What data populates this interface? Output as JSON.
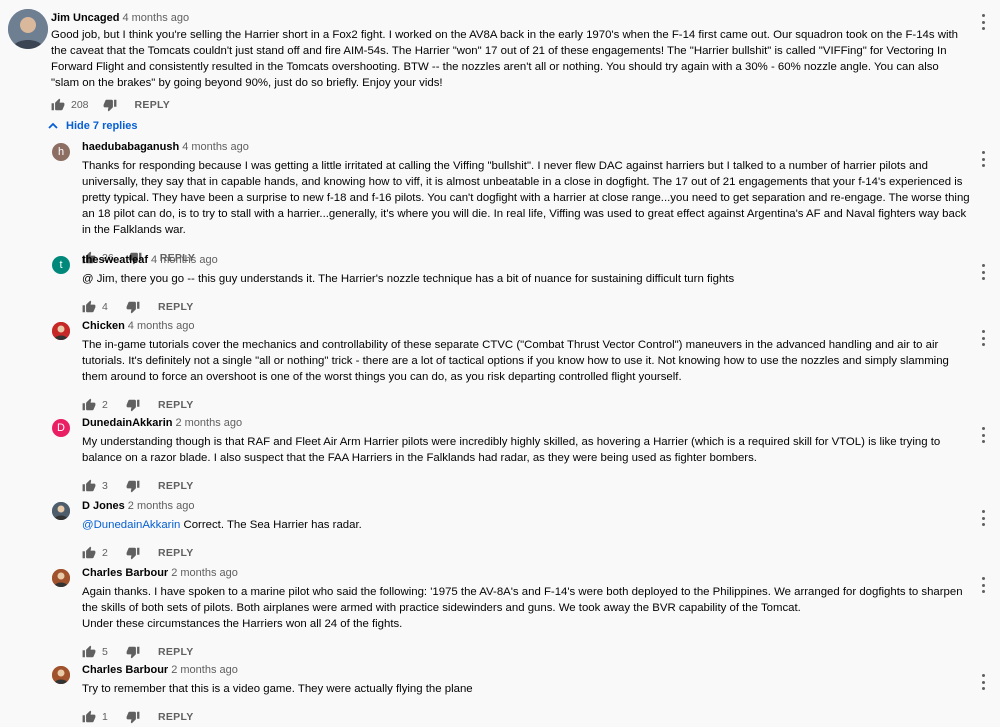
{
  "top_comment": {
    "author": "Jim Uncaged",
    "time": "4 months ago",
    "text": "Good job, but I think you're selling the Harrier short in a Fox2 fight.  I worked on the AV8A back in the early 1970's when the F-14 first came out.  Our squadron took on the F-14s with the caveat that the Tomcats couldn't just stand off and fire AIM-54s.  The Harrier \"won\" 17 out of 21 of these engagements!  The \"Harrier bullshit\" is called \"VIFFing\" for Vectoring In Forward Flight and consistently resulted in the Tomcats overshooting.  BTW -- the nozzles aren't all or nothing.  You should try again with a 30% - 60% nozzle angle.  You can also \"slam on the brakes\" by going beyond 90%, just do so briefly.  Enjoy your vids!",
    "likes": "208",
    "reply_label": "REPLY"
  },
  "hide_replies_label": "Hide 7 replies",
  "replies": [
    {
      "author": "haedubabaganush",
      "time": "4 months ago",
      "avatar_letter": "h",
      "avatar_color": "#8d6e63",
      "text": "Thanks for responding because I was getting a little irritated at calling the Viffing \"bullshit\". I never flew DAC against harriers but I talked to a number of harrier pilots and universally, they say that in capable hands,  and knowing how to viff, it is almost unbeatable in a close in dogfight. The 17 out of 21 engagements that your f-14's experienced is pretty typical. They have been a surprise to new f-18  and f-16 pilots. You can't dogfight with a harrier at close range...you need to get separation and re-engage. The worse thing an 18 pilot can do, is to try to stall with a harrier...generally, it's where you will die. In real life, Viffing was used to great effect against Argentina's AF and Naval fighters way back in the Falklands war.",
      "likes": "26",
      "reply_label": "REPLY"
    },
    {
      "author": "thesweatleaf",
      "time": "4 months ago",
      "avatar_letter": "t",
      "avatar_color": "#00897b",
      "text": "@ Jim, there you go -- this guy understands it. The Harrier's nozzle technique has a bit of nuance for sustaining difficult turn fights",
      "likes": "4",
      "reply_label": "REPLY"
    },
    {
      "author": "Chicken",
      "time": "4 months ago",
      "avatar_letter": "",
      "avatar_color": "#c62828",
      "text": "The in-game tutorials cover the mechanics and controllability of these separate CTVC (\"Combat Thrust Vector Control\") maneuvers in the advanced handling and air to air tutorials. It's definitely not a single \"all or nothing\" trick - there are a lot of tactical options if you know how to use it. Not knowing how to use the nozzles and simply slamming them around to force an overshoot is one of the worst things you can do, as you risk departing controlled flight yourself.",
      "likes": "2",
      "reply_label": "REPLY"
    },
    {
      "author": "DunedainAkkarin",
      "time": "2 months ago",
      "avatar_letter": "D",
      "avatar_color": "#e91e63",
      "text": "My understanding though is that RAF and Fleet Air Arm Harrier pilots were incredibly highly skilled, as hovering a Harrier (which is a required skill for VTOL) is like trying to balance on a razor blade. I also suspect that the FAA Harriers in the Falklands had radar, as they were being used as fighter bombers.",
      "likes": "3",
      "reply_label": "REPLY"
    },
    {
      "author": "D Jones",
      "time": "2 months ago",
      "avatar_letter": "",
      "avatar_color": "#4e5d6c",
      "mention": "@DunedainAkkarin",
      "text": " Correct.  The Sea Harrier has radar.",
      "likes": "2",
      "reply_label": "REPLY"
    },
    {
      "author": "Charles Barbour",
      "time": "2 months ago",
      "avatar_letter": "",
      "avatar_color": "#a0522d",
      "text": "Again thanks. I have spoken to a marine pilot who said the following: '1975 the AV-8A's and F-14's were both deployed to the Philippines. We arranged for dogfights to sharpen the skills of both sets of  pilots. Both airplanes were armed with practice sidewinders and guns. We took away the BVR capability of the Tomcat.",
      "text2": "Under these circumstances the Harriers won all 24 of the fights.",
      "likes": "5",
      "reply_label": "REPLY"
    },
    {
      "author": "Charles Barbour",
      "time": "2 months ago",
      "avatar_letter": "",
      "avatar_color": "#a0522d",
      "text": "Try to remember that this is a video game. They were actually flying the plane",
      "likes": "1",
      "reply_label": "REPLY"
    }
  ],
  "colors": {
    "background": "#f9f9f9",
    "link": "#065fd4",
    "secondary_text": "#606060"
  }
}
